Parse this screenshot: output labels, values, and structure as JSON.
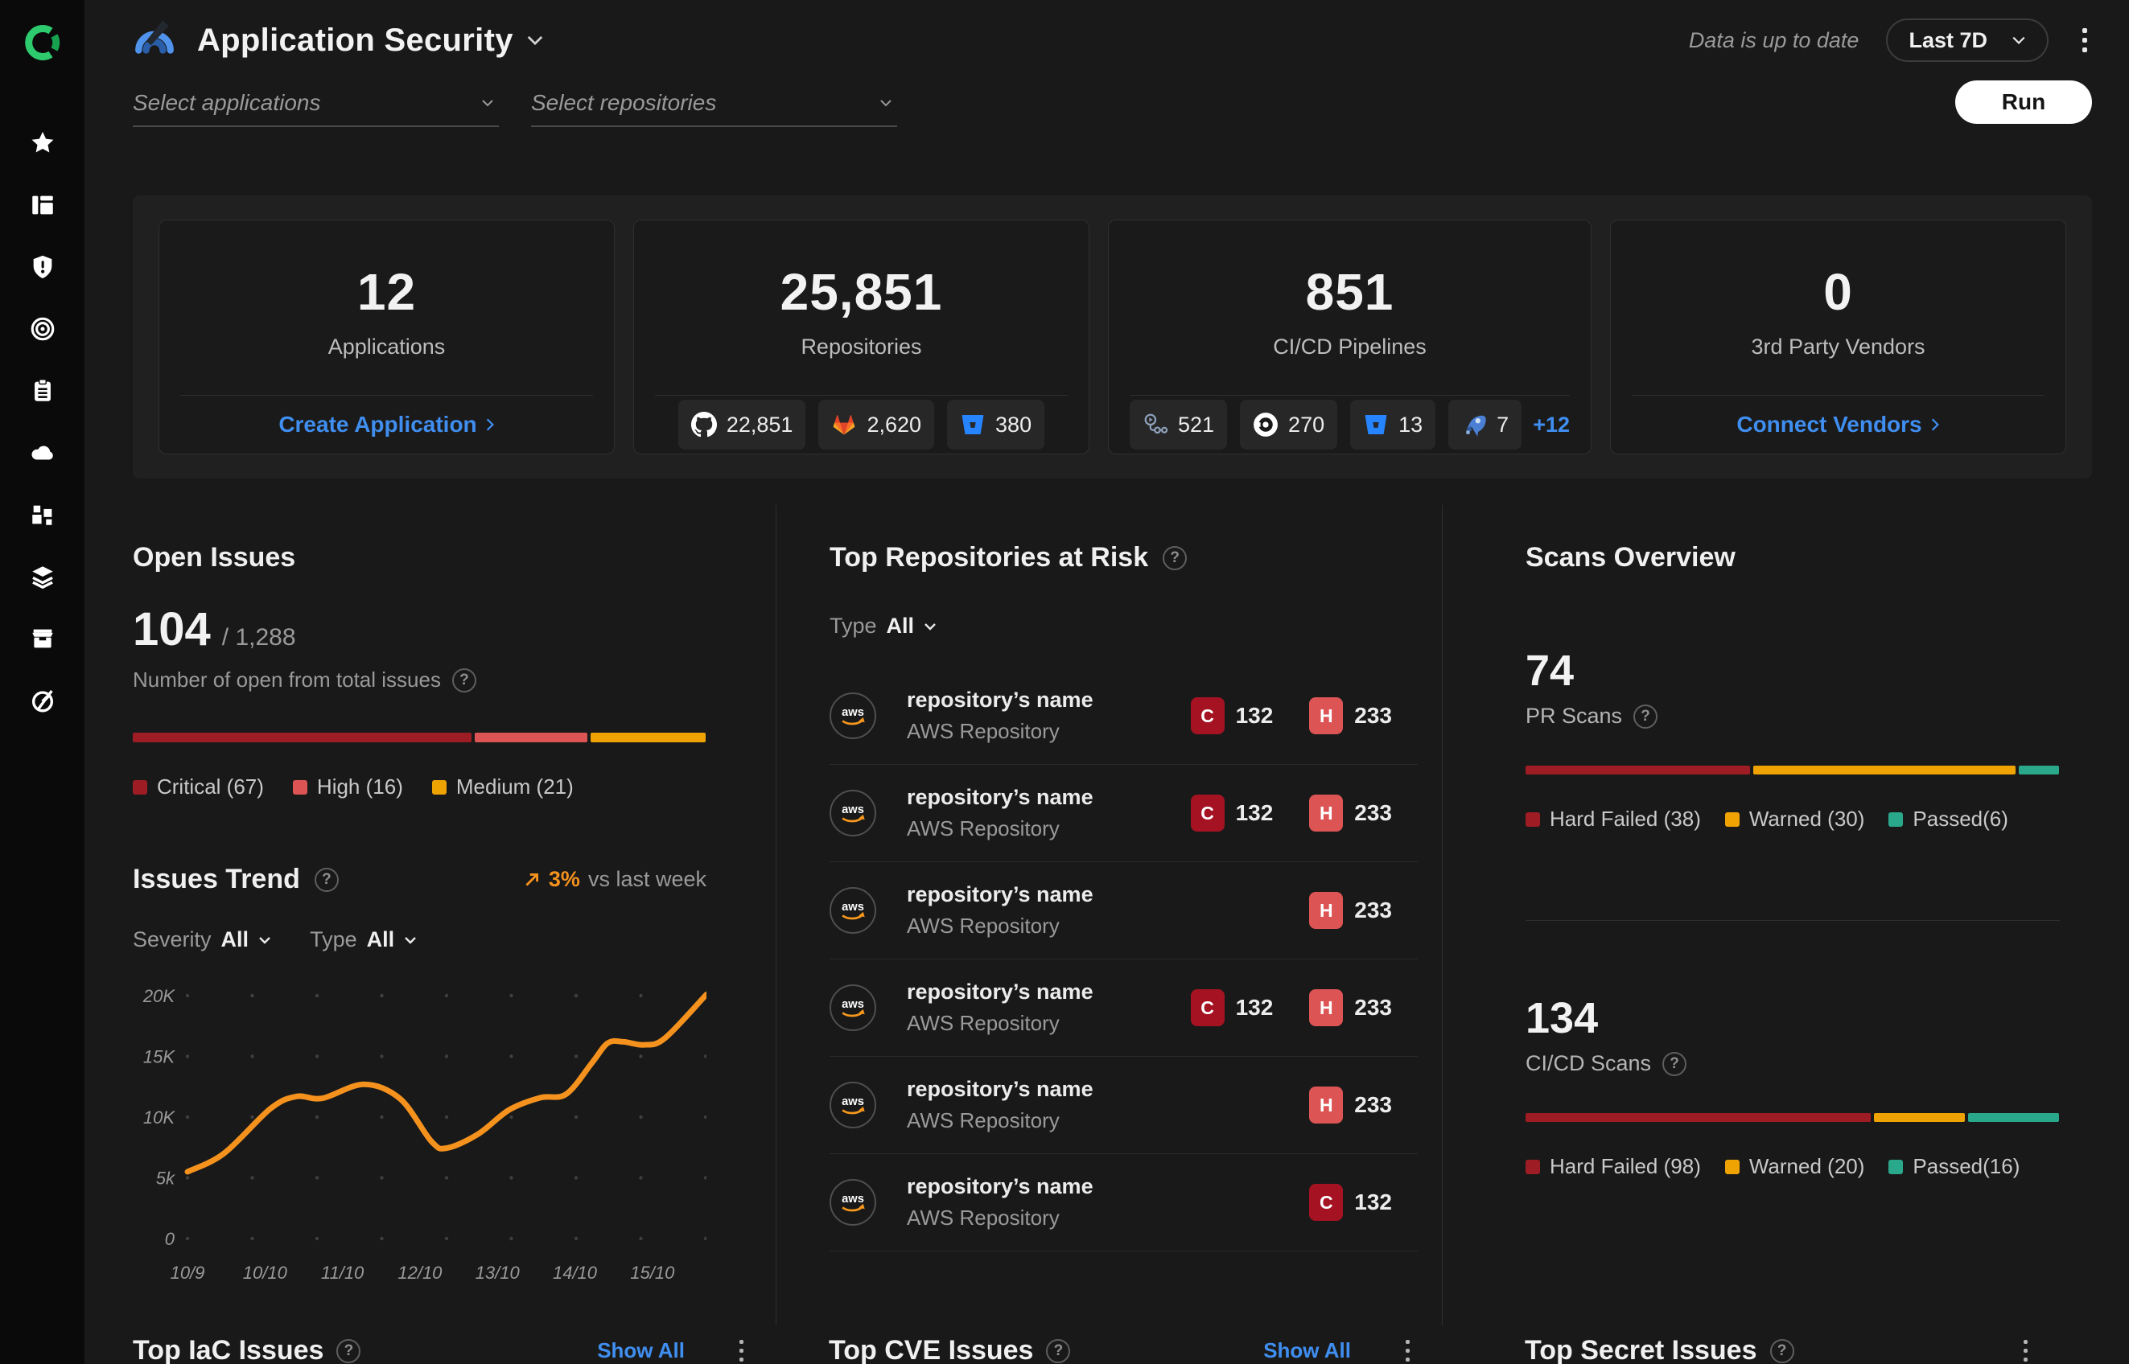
{
  "colors": {
    "accent_blue": "#3f8ef0",
    "trend_orange": "#f5921e",
    "critical_red": "#9e1c23",
    "high_red": "#dd5454",
    "medium_amber": "#efa303",
    "passed_teal": "#2aa88b",
    "run_button_bg": "#ffffff"
  },
  "sidebar": {
    "items": [
      "favorites",
      "dashboard",
      "shield-alert",
      "target",
      "report",
      "cloud",
      "integrations",
      "layers",
      "marketplace",
      "gauge"
    ]
  },
  "header": {
    "title": "Application Security",
    "status": "Data is up to date",
    "range": "Last 7D"
  },
  "filters": {
    "applications_placeholder": "Select applications",
    "repositories_placeholder": "Select repositories",
    "run_label": "Run"
  },
  "cards": {
    "applications": {
      "value": "12",
      "label": "Applications",
      "link": "Create Application"
    },
    "repositories": {
      "value": "25,851",
      "label": "Repositories",
      "sources": [
        {
          "name": "github",
          "count": "22,851"
        },
        {
          "name": "gitlab",
          "count": "2,620"
        },
        {
          "name": "bitbucket",
          "count": "380"
        }
      ]
    },
    "pipelines": {
      "value": "851",
      "label": "CI/CD Pipelines",
      "sources": [
        {
          "name": "github-actions",
          "count": "521"
        },
        {
          "name": "circleci",
          "count": "270"
        },
        {
          "name": "bitbucket",
          "count": "13"
        },
        {
          "name": "azure-pipelines",
          "count": "7"
        }
      ],
      "more": "+12"
    },
    "vendors": {
      "value": "0",
      "label": "3rd Party Vendors",
      "link": "Connect Vendors"
    }
  },
  "open_issues": {
    "title": "Open Issues",
    "open": "104",
    "total": "/ 1,288",
    "subtitle": "Number of open from total issues"
  },
  "issues_trend": {
    "title": "Issues Trend",
    "delta": "3%",
    "delta_note": "vs last week",
    "severity_label": "Severity",
    "severity_value": "All",
    "type_label": "Type",
    "type_value": "All"
  },
  "top_repos": {
    "title": "Top Repositories at Risk",
    "type_label": "Type",
    "type_value": "All",
    "avatar_text": "aws",
    "rows": [
      {
        "name": "repository’s name",
        "subtitle": "AWS Repository",
        "badges": [
          {
            "letter": "C",
            "count": "132",
            "color": "#a51323"
          },
          {
            "letter": "H",
            "count": "233",
            "color": "#dd5454"
          }
        ]
      },
      {
        "name": "repository’s name",
        "subtitle": "AWS Repository",
        "badges": [
          {
            "letter": "C",
            "count": "132",
            "color": "#a51323"
          },
          {
            "letter": "H",
            "count": "233",
            "color": "#dd5454"
          }
        ]
      },
      {
        "name": "repository’s name",
        "subtitle": "AWS Repository",
        "badges": [
          {
            "letter": "H",
            "count": "233",
            "color": "#dd5454"
          }
        ]
      },
      {
        "name": "repository’s name",
        "subtitle": "AWS Repository",
        "badges": [
          {
            "letter": "C",
            "count": "132",
            "color": "#a51323"
          },
          {
            "letter": "H",
            "count": "233",
            "color": "#dd5454"
          }
        ]
      },
      {
        "name": "repository’s name",
        "subtitle": "AWS Repository",
        "badges": [
          {
            "letter": "H",
            "count": "233",
            "color": "#dd5454"
          }
        ]
      },
      {
        "name": "repository’s name",
        "subtitle": "AWS Repository",
        "badges": [
          {
            "letter": "C",
            "count": "132",
            "color": "#a51323"
          }
        ]
      }
    ]
  },
  "scans": {
    "title": "Scans Overview",
    "pr": {
      "value": "74",
      "label": "PR Scans"
    },
    "cicd": {
      "value": "134",
      "label": "CI/CD Scans"
    }
  },
  "footer": {
    "iac": {
      "title": "Top IaC Issues",
      "show_all": "Show All"
    },
    "cve": {
      "title": "Top CVE Issues",
      "show_all": "Show All"
    },
    "secrets": {
      "title": "Top Secret Issues"
    }
  },
  "icons": {
    "help": "?"
  },
  "chart_data": [
    {
      "id": "issues_trend",
      "type": "line",
      "title": "Issues Trend",
      "x_ticks": [
        "10/9",
        "10/10",
        "11/10",
        "12/10",
        "13/10",
        "14/10",
        "15/10"
      ],
      "y_ticks": [
        "0",
        "5k",
        "10K",
        "15K",
        "20K"
      ],
      "ylim": [
        0,
        20000
      ],
      "grid": "dotted",
      "legend_position": "none",
      "series": [
        {
          "name": "issues",
          "color": "#f5921e",
          "points": [
            [
              0,
              5500
            ],
            [
              0.07,
              7000
            ],
            [
              0.16,
              10700
            ],
            [
              0.21,
              11700
            ],
            [
              0.26,
              11550
            ],
            [
              0.34,
              12700
            ],
            [
              0.41,
              11500
            ],
            [
              0.47,
              8000
            ],
            [
              0.5,
              7450
            ],
            [
              0.56,
              8600
            ],
            [
              0.62,
              10600
            ],
            [
              0.68,
              11600
            ],
            [
              0.73,
              11900
            ],
            [
              0.78,
              14500
            ],
            [
              0.81,
              16100
            ],
            [
              0.84,
              16200
            ],
            [
              0.88,
              15950
            ],
            [
              0.92,
              16500
            ],
            [
              1,
              20100
            ]
          ]
        }
      ]
    },
    {
      "id": "open_issues_severity",
      "type": "stacked_bar",
      "total": 104,
      "segments": [
        {
          "label": "Critical (67)",
          "value": 67,
          "width_pct": 59.5,
          "color": "#9e1c23"
        },
        {
          "label": "High (16)",
          "value": 16,
          "width_pct": 20,
          "color": "#dd5454"
        },
        {
          "label": "Medium (21)",
          "value": 21,
          "width_pct": 20.5,
          "color": "#efa303"
        }
      ]
    },
    {
      "id": "pr_scans",
      "type": "stacked_bar",
      "total": 74,
      "segments": [
        {
          "label": "Hard Failed (38)",
          "value": 38,
          "width_pct": 42.5,
          "color": "#9e1c23"
        },
        {
          "label": "Warned (30)",
          "value": 30,
          "width_pct": 49.5,
          "color": "#efa303"
        },
        {
          "label": "Passed(6)",
          "value": 6,
          "width_pct": 8,
          "color": "#2aa88b"
        }
      ]
    },
    {
      "id": "cicd_scans",
      "type": "stacked_bar",
      "total": 134,
      "segments": [
        {
          "label": "Hard Failed (98)",
          "value": 98,
          "width_pct": 65,
          "color": "#9e1c23"
        },
        {
          "label": "Warned (20)",
          "value": 20,
          "width_pct": 17.5,
          "color": "#efa303"
        },
        {
          "label": "Passed(16)",
          "value": 16,
          "width_pct": 17.5,
          "color": "#2aa88b"
        }
      ]
    }
  ]
}
